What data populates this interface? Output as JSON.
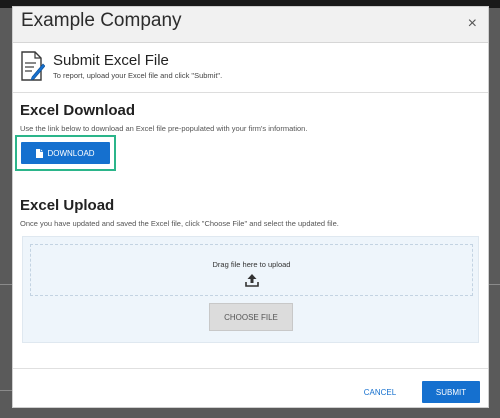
{
  "modal": {
    "title": "Example Company",
    "close_glyph": "×"
  },
  "intro": {
    "icon": "file-edit-icon",
    "title": "Submit Excel File",
    "subtitle": "To report, upload your Excel file and click \"Submit\"."
  },
  "download_section": {
    "title": "Excel Download",
    "description": "Use the link below to download an Excel file pre-populated with your firm's information.",
    "button_label": "DOWNLOAD",
    "button_icon": "document-icon"
  },
  "upload_section": {
    "title": "Excel Upload",
    "description": "Once you have updated and saved the Excel file, click \"Choose File\" and select the updated file.",
    "drop_text": "Drag file here to upload",
    "upload_icon": "upload-icon",
    "choose_button_label": "CHOOSE FILE"
  },
  "footer": {
    "cancel_label": "CANCEL",
    "submit_label": "SUBMIT"
  },
  "colors": {
    "primary": "#1570cf",
    "highlight_outline": "#2bb58a",
    "upload_bg": "#eef5fb"
  }
}
